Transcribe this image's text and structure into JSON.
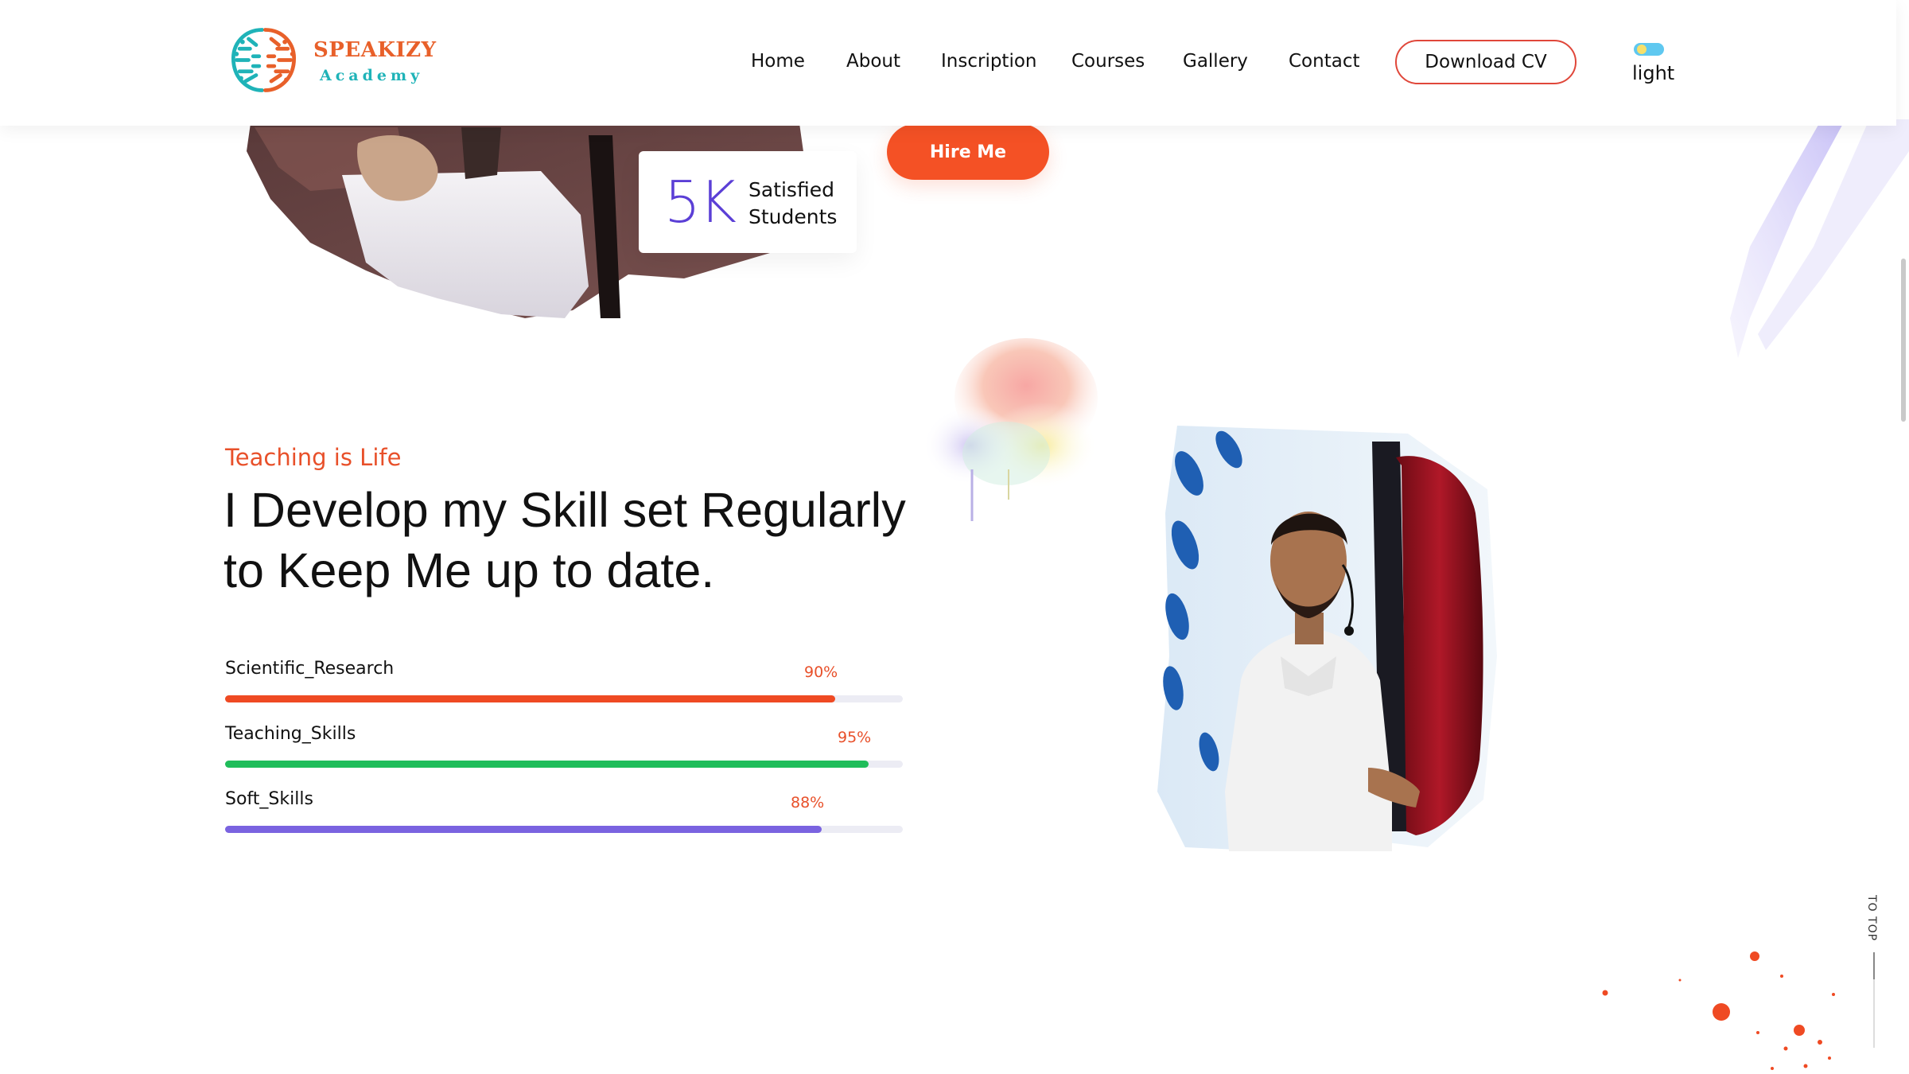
{
  "brand": {
    "name": "SPEAKIZY",
    "tagline": "Academy"
  },
  "nav": {
    "items": [
      "Home",
      "About",
      "Inscription",
      "Courses",
      "Gallery",
      "Contact"
    ],
    "download_cv": "Download CV",
    "theme_label": "light"
  },
  "hero": {
    "stat_number": "5K",
    "stat_line1": "Satisfied",
    "stat_line2": "Students",
    "hire_button": "Hire Me"
  },
  "skills_section": {
    "eyebrow": "Teaching is Life",
    "headline_line1": "I Develop my Skill set Regularly",
    "headline_line2": "to Keep Me up to date.",
    "skills": [
      {
        "name": "Scientific_Research",
        "percent_label": "90%",
        "value": 0.9,
        "color": "#ef4a23"
      },
      {
        "name": "Teaching_Skills",
        "percent_label": "95%",
        "value": 0.95,
        "color": "#1fbd5a"
      },
      {
        "name": "Soft_Skills",
        "percent_label": "88%",
        "value": 0.88,
        "color": "#7a63e0"
      }
    ]
  },
  "to_top": {
    "label": "TO TOP"
  },
  "colors": {
    "accent": "#f45125",
    "purple": "#5b3fd6",
    "teal": "#1fb3b8"
  },
  "icons": [
    "speakizy-logo-icon",
    "theme-toggle-icon"
  ]
}
